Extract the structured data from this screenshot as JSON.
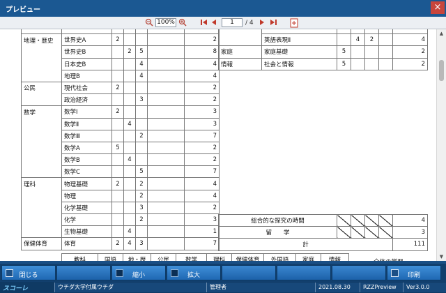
{
  "window": {
    "title": "プレビュー",
    "close_glyph": "×"
  },
  "toolbar": {
    "zoom_value": "100%",
    "page_current": "1",
    "page_total": "/ 4"
  },
  "left_table": [
    {
      "category": "",
      "subject": "",
      "c1": "",
      "c2": "",
      "c3": "",
      "c4": "",
      "total": ""
    },
    {
      "category": "地理・歴史",
      "subject": "世界史A",
      "c1": "2",
      "c2": "",
      "c3": "",
      "c4": "",
      "total": "2"
    },
    {
      "category": "",
      "subject": "世界史B",
      "c1": "",
      "c2": "2",
      "c3": "5",
      "c4": "",
      "total": "8"
    },
    {
      "category": "",
      "subject": "日本史B",
      "c1": "",
      "c2": "",
      "c3": "4",
      "c4": "",
      "total": "4"
    },
    {
      "category": "",
      "subject": "地理B",
      "c1": "",
      "c2": "",
      "c3": "4",
      "c4": "",
      "total": "4"
    },
    {
      "category": "公民",
      "subject": "現代社会",
      "c1": "2",
      "c2": "",
      "c3": "",
      "c4": "",
      "total": "2"
    },
    {
      "category": "",
      "subject": "政治経済",
      "c1": "",
      "c2": "",
      "c3": "3",
      "c4": "",
      "total": "2"
    },
    {
      "category": "数学",
      "subject": "数学Ⅰ",
      "c1": "2",
      "c2": "",
      "c3": "",
      "c4": "",
      "total": "3"
    },
    {
      "category": "",
      "subject": "数学Ⅱ",
      "c1": "",
      "c2": "4",
      "c3": "",
      "c4": "",
      "total": "3"
    },
    {
      "category": "",
      "subject": "数学Ⅲ",
      "c1": "",
      "c2": "",
      "c3": "2",
      "c4": "",
      "total": "7"
    },
    {
      "category": "",
      "subject": "数学A",
      "c1": "5",
      "c2": "",
      "c3": "",
      "c4": "",
      "total": "2"
    },
    {
      "category": "",
      "subject": "数学B",
      "c1": "",
      "c2": "4",
      "c3": "",
      "c4": "",
      "total": "2"
    },
    {
      "category": "",
      "subject": "数学C",
      "c1": "",
      "c2": "",
      "c3": "5",
      "c4": "",
      "total": "7"
    },
    {
      "category": "理科",
      "subject": "物理基礎",
      "c1": "2",
      "c2": "",
      "c3": "2",
      "c4": "",
      "total": "4"
    },
    {
      "category": "",
      "subject": "物理",
      "c1": "",
      "c2": "",
      "c3": "2",
      "c4": "",
      "total": "4"
    },
    {
      "category": "",
      "subject": "化学基礎",
      "c1": "",
      "c2": "",
      "c3": "3",
      "c4": "",
      "total": "2"
    },
    {
      "category": "",
      "subject": "化学",
      "c1": "",
      "c2": "",
      "c3": "2",
      "c4": "",
      "total": "3"
    },
    {
      "category": "",
      "subject": "生物基礎",
      "c1": "",
      "c2": "4",
      "c3": "",
      "c4": "",
      "total": "1"
    },
    {
      "category": "保健体育",
      "subject": "体育",
      "c1": "2",
      "c2": "4",
      "c3": "3",
      "c4": "",
      "total": "7"
    }
  ],
  "right_table": [
    {
      "category": "",
      "subject": "",
      "c1": "",
      "c2": "",
      "c3": "",
      "c4": "",
      "total": ""
    },
    {
      "category": "",
      "subject": "英語表現Ⅱ",
      "c1": "",
      "c2": "4",
      "c3": "2",
      "c4": "",
      "total": "4"
    },
    {
      "category": "家庭",
      "subject": "家庭基礎",
      "c1": "5",
      "c2": "",
      "c3": "",
      "c4": "",
      "total": "2"
    },
    {
      "category": "情報",
      "subject": "社会と情報",
      "c1": "5",
      "c2": "",
      "c3": "",
      "c4": "",
      "total": "2"
    }
  ],
  "summary_rows": [
    {
      "label": "総合的な探究の時間",
      "total": "4"
    },
    {
      "label": "留　　学",
      "total": "3"
    },
    {
      "label": "計",
      "total": "111"
    }
  ],
  "footer_headers": [
    "教科",
    "国語",
    "地・歴",
    "公民",
    "数学",
    "理科",
    "保健体育",
    "外国語",
    "家庭",
    "情報",
    "全体の学習"
  ],
  "buttons": {
    "close": "閉じる",
    "shrink": "縮小",
    "enlarge": "拡大",
    "print": "印刷"
  },
  "status": {
    "logo": "スコーレ",
    "school": "ウチダ大学付属ウチダ",
    "user": "管理者",
    "date": "2021.08.30",
    "app": "RZZPreview",
    "version": "Ver3.0.0"
  }
}
